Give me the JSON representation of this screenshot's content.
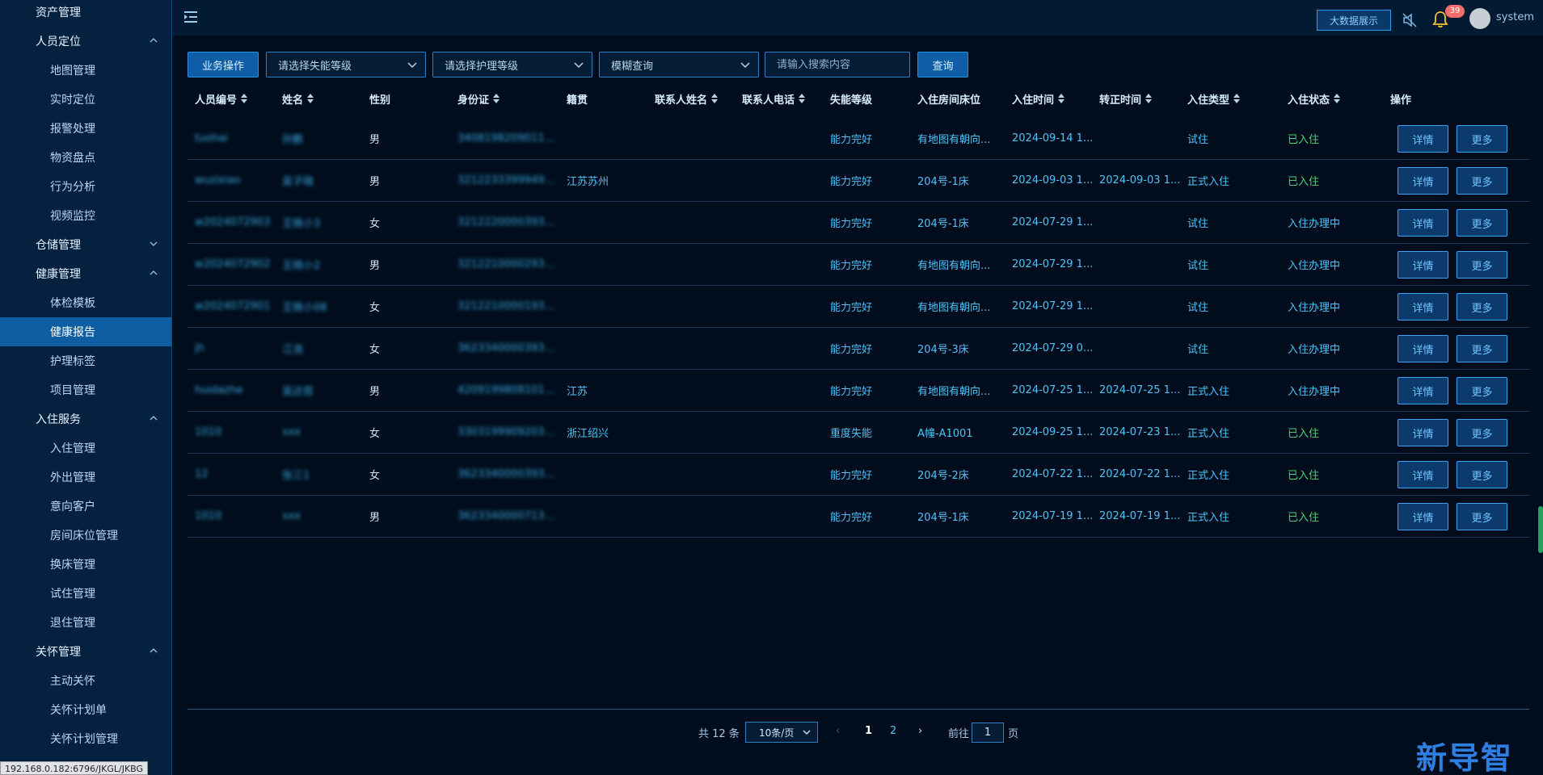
{
  "sidebar": {
    "items": [
      {
        "label": "资产管理",
        "type": "group",
        "icon": ""
      },
      {
        "label": "人员定位",
        "type": "group",
        "icon": "chevron-up-icon"
      },
      {
        "label": "地图管理",
        "type": "child"
      },
      {
        "label": "实时定位",
        "type": "child"
      },
      {
        "label": "报警处理",
        "type": "child"
      },
      {
        "label": "物资盘点",
        "type": "child"
      },
      {
        "label": "行为分析",
        "type": "child"
      },
      {
        "label": "视频监控",
        "type": "child"
      },
      {
        "label": "仓储管理",
        "type": "group",
        "icon": "chevron-down-icon"
      },
      {
        "label": "健康管理",
        "type": "group",
        "icon": "chevron-up-icon"
      },
      {
        "label": "体检模板",
        "type": "child"
      },
      {
        "label": "健康报告",
        "type": "child",
        "active": true
      },
      {
        "label": "护理标签",
        "type": "child"
      },
      {
        "label": "项目管理",
        "type": "child"
      },
      {
        "label": "入住服务",
        "type": "group",
        "icon": "chevron-up-icon"
      },
      {
        "label": "入住管理",
        "type": "child"
      },
      {
        "label": "外出管理",
        "type": "child"
      },
      {
        "label": "意向客户",
        "type": "child"
      },
      {
        "label": "房间床位管理",
        "type": "child"
      },
      {
        "label": "换床管理",
        "type": "child"
      },
      {
        "label": "试住管理",
        "type": "child"
      },
      {
        "label": "退住管理",
        "type": "child"
      },
      {
        "label": "关怀管理",
        "type": "group",
        "icon": "chevron-up-icon"
      },
      {
        "label": "主动关怀",
        "type": "child"
      },
      {
        "label": "关怀计划单",
        "type": "child"
      },
      {
        "label": "关怀计划管理",
        "type": "child"
      }
    ]
  },
  "status_url": "192.168.0.182:6796/JKGL/JKBG",
  "topbar": {
    "bigscreen_label": "大数据展示",
    "badge_count": "39",
    "username": "system"
  },
  "filters": {
    "ops_label": "业务操作",
    "disability_placeholder": "请选择失能等级",
    "care_placeholder": "请选择护理等级",
    "mode_label": "模糊查询",
    "search_placeholder": "请输入搜索内容",
    "query_label": "查询"
  },
  "table": {
    "columns": [
      "人员编号",
      "姓名",
      "性别",
      "身份证",
      "籍贯",
      "联系人姓名",
      "联系人电话",
      "失能等级",
      "入住房间床位",
      "入住时间",
      "转正时间",
      "入住类型",
      "入住状态",
      "操作"
    ],
    "rows": [
      {
        "id": "tuohai",
        "name": "孙鹏",
        "gender": "男",
        "idcard": "3408198209011...",
        "origin": "",
        "contact_name": "",
        "contact_phone": "",
        "level": "能力完好",
        "room": "有地图有朝向...",
        "checkin": "2024-09-14 1...",
        "regular": "",
        "type": "试住",
        "status": "已入住"
      },
      {
        "id": "wuzixiao",
        "name": "吴子晓",
        "gender": "男",
        "idcard": "3212233399949...",
        "origin": "江苏苏州",
        "contact_name": "",
        "contact_phone": "",
        "level": "能力完好",
        "room": "204号-1床",
        "checkin": "2024-09-03 1...",
        "regular": "2024-09-03 1...",
        "type": "正式入住",
        "status": "已入住"
      },
      {
        "id": "w2024072903",
        "name": "王晓小3",
        "gender": "女",
        "idcard": "3212220000393...",
        "origin": "",
        "contact_name": "",
        "contact_phone": "",
        "level": "能力完好",
        "room": "204号-1床",
        "checkin": "2024-07-29 1...",
        "regular": "",
        "type": "试住",
        "status": "入住办理中"
      },
      {
        "id": "w2024072902",
        "name": "王晓小2",
        "gender": "男",
        "idcard": "3212210000293...",
        "origin": "",
        "contact_name": "",
        "contact_phone": "",
        "level": "能力完好",
        "room": "有地图有朝向...",
        "checkin": "2024-07-29 1...",
        "regular": "",
        "type": "试住",
        "status": "入住办理中"
      },
      {
        "id": "w2024072901",
        "name": "王晓小08",
        "gender": "女",
        "idcard": "3212210000193...",
        "origin": "",
        "contact_name": "",
        "contact_phone": "",
        "level": "能力完好",
        "room": "有地图有朝向...",
        "checkin": "2024-07-29 1...",
        "regular": "",
        "type": "试住",
        "status": "入住办理中"
      },
      {
        "id": "jh",
        "name": "江浩",
        "gender": "女",
        "idcard": "3623340000393...",
        "origin": "",
        "contact_name": "",
        "contact_phone": "",
        "level": "能力完好",
        "room": "204号-3床",
        "checkin": "2024-07-29 0...",
        "regular": "",
        "type": "试住",
        "status": "入住办理中"
      },
      {
        "id": "huidazhe",
        "name": "吴达哲",
        "gender": "男",
        "idcard": "4209199808101...",
        "origin": "江苏",
        "contact_name": "",
        "contact_phone": "",
        "level": "能力完好",
        "room": "有地图有朝向...",
        "checkin": "2024-07-25 1...",
        "regular": "2024-07-25 1...",
        "type": "正式入住",
        "status": "入住办理中"
      },
      {
        "id": "1010",
        "name": "xxx",
        "gender": "女",
        "idcard": "3303199909203...",
        "origin": "浙江绍兴",
        "contact_name": "",
        "contact_phone": "",
        "level": "重度失能",
        "room": "A幢-A1001",
        "checkin": "2024-09-25 1...",
        "regular": "2024-07-23 1...",
        "type": "正式入住",
        "status": "已入住"
      },
      {
        "id": "12",
        "name": "张三1",
        "gender": "女",
        "idcard": "3623340000393...",
        "origin": "",
        "contact_name": "",
        "contact_phone": "",
        "level": "能力完好",
        "room": "204号-2床",
        "checkin": "2024-07-22 1...",
        "regular": "2024-07-22 1...",
        "type": "正式入住",
        "status": "已入住"
      },
      {
        "id": "1010",
        "name": "xxx",
        "gender": "男",
        "idcard": "3623340000713...",
        "origin": "",
        "contact_name": "",
        "contact_phone": "",
        "level": "能力完好",
        "room": "204号-1床",
        "checkin": "2024-07-19 1...",
        "regular": "2024-07-19 1...",
        "type": "正式入住",
        "status": "已入住"
      }
    ],
    "detail_label": "详情",
    "more_label": "更多"
  },
  "pagination": {
    "total": "共 12 条",
    "page_size": "10条/页",
    "prev": "‹",
    "pages": [
      "1",
      "2"
    ],
    "next": "›",
    "goto_prefix": "前往",
    "goto_value": "1",
    "goto_suffix": "页"
  },
  "watermark": "新导智能",
  "colors": {
    "accent": "#0f5da6",
    "ok": "#4bd37a",
    "cell": "#4fc3f7",
    "sidebar": "#04213f",
    "bg": "#010d1c"
  }
}
